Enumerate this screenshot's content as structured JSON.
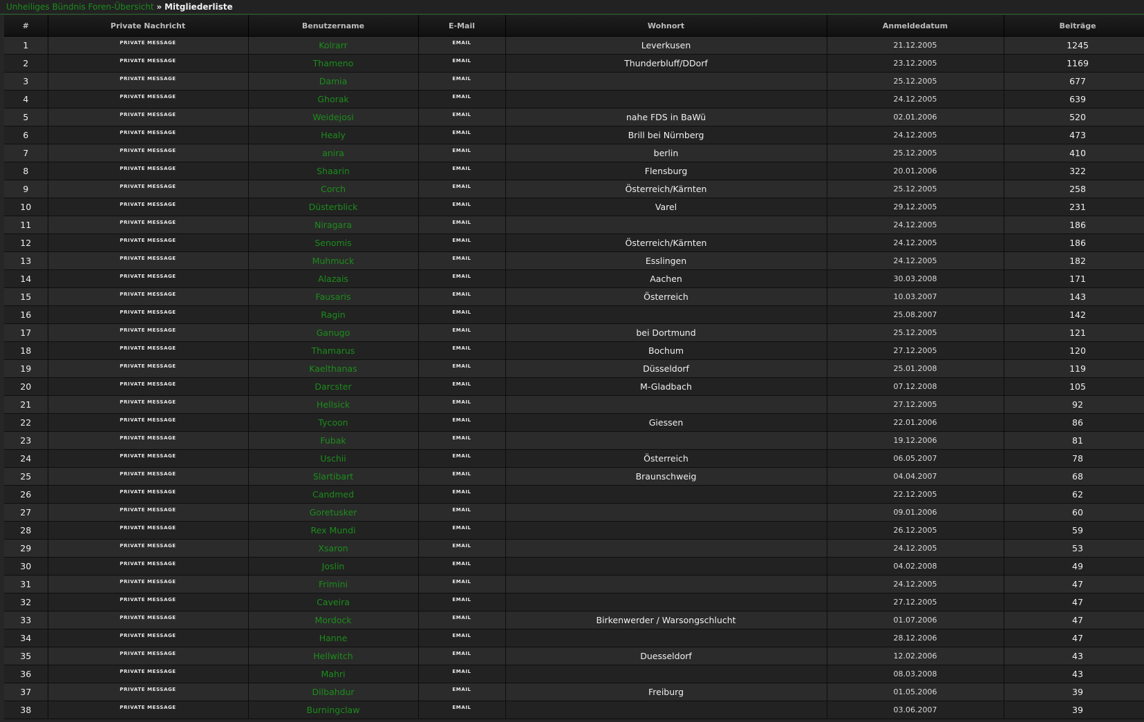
{
  "breadcrumb": {
    "forum_link": "Unheiliges Bündnis Foren-Übersicht",
    "separator": "»",
    "current": "Mitgliederliste"
  },
  "colors": {
    "accent": "#1b8d1b",
    "background": "#262626"
  },
  "table": {
    "headers": [
      "#",
      "Private Nachricht",
      "Benutzername",
      "E-Mail",
      "Wohnort",
      "Anmeldedatum",
      "Beiträge"
    ],
    "rows": [
      {
        "n": "1",
        "pm": "PRIVATE MESSAGE",
        "user": "Kolrarr",
        "email": "EMAIL",
        "loc": "Leverkusen",
        "date": "21.12.2005",
        "posts": "1245"
      },
      {
        "n": "2",
        "pm": "PRIVATE MESSAGE",
        "user": "Thameno",
        "email": "EMAIL",
        "loc": "Thunderbluff/DDorf",
        "date": "23.12.2005",
        "posts": "1169"
      },
      {
        "n": "3",
        "pm": "PRIVATE MESSAGE",
        "user": "Damia",
        "email": "EMAIL",
        "loc": "",
        "date": "25.12.2005",
        "posts": "677"
      },
      {
        "n": "4",
        "pm": "PRIVATE MESSAGE",
        "user": "Ghorak",
        "email": "EMAIL",
        "loc": "",
        "date": "24.12.2005",
        "posts": "639"
      },
      {
        "n": "5",
        "pm": "PRIVATE MESSAGE",
        "user": "Weidejosi",
        "email": "EMAIL",
        "loc": "nahe FDS in BaWü",
        "date": "02.01.2006",
        "posts": "520"
      },
      {
        "n": "6",
        "pm": "PRIVATE MESSAGE",
        "user": "Healy",
        "email": "EMAIL",
        "loc": "Brill bei Nürnberg",
        "date": "24.12.2005",
        "posts": "473"
      },
      {
        "n": "7",
        "pm": "PRIVATE MESSAGE",
        "user": "anira",
        "email": "EMAIL",
        "loc": "berlin",
        "date": "25.12.2005",
        "posts": "410"
      },
      {
        "n": "8",
        "pm": "PRIVATE MESSAGE",
        "user": "Shaarin",
        "email": "EMAIL",
        "loc": "Flensburg",
        "date": "20.01.2006",
        "posts": "322"
      },
      {
        "n": "9",
        "pm": "PRIVATE MESSAGE",
        "user": "Corch",
        "email": "EMAIL",
        "loc": "Österreich/Kärnten",
        "date": "25.12.2005",
        "posts": "258"
      },
      {
        "n": "10",
        "pm": "PRIVATE MESSAGE",
        "user": "Düsterblick",
        "email": "EMAIL",
        "loc": "Varel",
        "date": "29.12.2005",
        "posts": "231"
      },
      {
        "n": "11",
        "pm": "PRIVATE MESSAGE",
        "user": "Niragara",
        "email": "EMAIL",
        "loc": "",
        "date": "24.12.2005",
        "posts": "186"
      },
      {
        "n": "12",
        "pm": "PRIVATE MESSAGE",
        "user": "Senomis",
        "email": "EMAIL",
        "loc": "Österreich/Kärnten",
        "date": "24.12.2005",
        "posts": "186"
      },
      {
        "n": "13",
        "pm": "PRIVATE MESSAGE",
        "user": "Muhmuck",
        "email": "EMAIL",
        "loc": "Esslingen",
        "date": "24.12.2005",
        "posts": "182"
      },
      {
        "n": "14",
        "pm": "PRIVATE MESSAGE",
        "user": "Alazais",
        "email": "EMAIL",
        "loc": "Aachen",
        "date": "30.03.2008",
        "posts": "171"
      },
      {
        "n": "15",
        "pm": "PRIVATE MESSAGE",
        "user": "Fausaris",
        "email": "EMAIL",
        "loc": "Österreich",
        "date": "10.03.2007",
        "posts": "143"
      },
      {
        "n": "16",
        "pm": "PRIVATE MESSAGE",
        "user": "Ragin",
        "email": "EMAIL",
        "loc": "",
        "date": "25.08.2007",
        "posts": "142"
      },
      {
        "n": "17",
        "pm": "PRIVATE MESSAGE",
        "user": "Ganugo",
        "email": "EMAIL",
        "loc": "bei Dortmund",
        "date": "25.12.2005",
        "posts": "121"
      },
      {
        "n": "18",
        "pm": "PRIVATE MESSAGE",
        "user": "Thamarus",
        "email": "EMAIL",
        "loc": "Bochum",
        "date": "27.12.2005",
        "posts": "120"
      },
      {
        "n": "19",
        "pm": "PRIVATE MESSAGE",
        "user": "Kaelthanas",
        "email": "EMAIL",
        "loc": "Düsseldorf",
        "date": "25.01.2008",
        "posts": "119"
      },
      {
        "n": "20",
        "pm": "PRIVATE MESSAGE",
        "user": "Darcster",
        "email": "EMAIL",
        "loc": "M-Gladbach",
        "date": "07.12.2008",
        "posts": "105"
      },
      {
        "n": "21",
        "pm": "PRIVATE MESSAGE",
        "user": "Hellsick",
        "email": "EMAIL",
        "loc": "",
        "date": "27.12.2005",
        "posts": "92"
      },
      {
        "n": "22",
        "pm": "PRIVATE MESSAGE",
        "user": "Tycoon",
        "email": "EMAIL",
        "loc": "Giessen",
        "date": "22.01.2006",
        "posts": "86"
      },
      {
        "n": "23",
        "pm": "PRIVATE MESSAGE",
        "user": "Fubak",
        "email": "EMAIL",
        "loc": "",
        "date": "19.12.2006",
        "posts": "81"
      },
      {
        "n": "24",
        "pm": "PRIVATE MESSAGE",
        "user": "Uschii",
        "email": "EMAIL",
        "loc": "Österreich",
        "date": "06.05.2007",
        "posts": "78"
      },
      {
        "n": "25",
        "pm": "PRIVATE MESSAGE",
        "user": "Slartibart",
        "email": "EMAIL",
        "loc": "Braunschweig",
        "date": "04.04.2007",
        "posts": "68"
      },
      {
        "n": "26",
        "pm": "PRIVATE MESSAGE",
        "user": "Candmed",
        "email": "EMAIL",
        "loc": "",
        "date": "22.12.2005",
        "posts": "62"
      },
      {
        "n": "27",
        "pm": "PRIVATE MESSAGE",
        "user": "Goretusker",
        "email": "EMAIL",
        "loc": "",
        "date": "09.01.2006",
        "posts": "60"
      },
      {
        "n": "28",
        "pm": "PRIVATE MESSAGE",
        "user": "Rex Mundi",
        "email": "EMAIL",
        "loc": "",
        "date": "26.12.2005",
        "posts": "59"
      },
      {
        "n": "29",
        "pm": "PRIVATE MESSAGE",
        "user": "Xsaron",
        "email": "EMAIL",
        "loc": "",
        "date": "24.12.2005",
        "posts": "53"
      },
      {
        "n": "30",
        "pm": "PRIVATE MESSAGE",
        "user": "Joslin",
        "email": "EMAIL",
        "loc": "",
        "date": "04.02.2008",
        "posts": "49"
      },
      {
        "n": "31",
        "pm": "PRIVATE MESSAGE",
        "user": "Frimini",
        "email": "EMAIL",
        "loc": "",
        "date": "24.12.2005",
        "posts": "47"
      },
      {
        "n": "32",
        "pm": "PRIVATE MESSAGE",
        "user": "Caveira",
        "email": "EMAIL",
        "loc": "",
        "date": "27.12.2005",
        "posts": "47"
      },
      {
        "n": "33",
        "pm": "PRIVATE MESSAGE",
        "user": "Mordock",
        "email": "EMAIL",
        "loc": "Birkenwerder / Warsongschlucht",
        "date": "01.07.2006",
        "posts": "47"
      },
      {
        "n": "34",
        "pm": "PRIVATE MESSAGE",
        "user": "Hanne",
        "email": "EMAIL",
        "loc": "",
        "date": "28.12.2006",
        "posts": "47"
      },
      {
        "n": "35",
        "pm": "PRIVATE MESSAGE",
        "user": "Hellwitch",
        "email": "EMAIL",
        "loc": "Duesseldorf",
        "date": "12.02.2006",
        "posts": "43"
      },
      {
        "n": "36",
        "pm": "PRIVATE MESSAGE",
        "user": "Mahri",
        "email": "EMAIL",
        "loc": "",
        "date": "08.03.2008",
        "posts": "43"
      },
      {
        "n": "37",
        "pm": "PRIVATE MESSAGE",
        "user": "Dilbahdur",
        "email": "EMAIL",
        "loc": "Freiburg",
        "date": "01.05.2006",
        "posts": "39"
      },
      {
        "n": "38",
        "pm": "PRIVATE MESSAGE",
        "user": "Burningclaw",
        "email": "EMAIL",
        "loc": "",
        "date": "03.06.2007",
        "posts": "39"
      }
    ]
  }
}
